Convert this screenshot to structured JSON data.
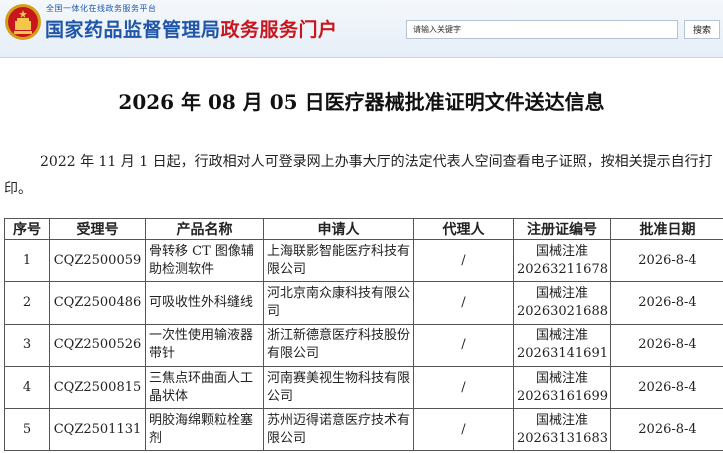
{
  "header": {
    "top_subtitle": "全国一体化在线政务服务平台",
    "site_name_blue": "国家药品监督管理局",
    "site_name_red": "政务服务门户",
    "search_placeholder": "请输入关键字",
    "search_button_label": "搜索"
  },
  "page": {
    "title": "2026 年 08 月 05 日医疗器械批准证明文件送达信息",
    "notice": "2022 年 11 月 1 日起，行政相对人可登录网上办事大厅的法定代表人空间查看电子证照，按相关提示自行打印。"
  },
  "table": {
    "headers": [
      "序号",
      "受理号",
      "产品名称",
      "申请人",
      "代理人",
      "注册证编号",
      "批准日期"
    ],
    "rows": [
      {
        "index": "1",
        "accept_no": "CQZ2500059",
        "product": "骨转移 CT 图像辅助检测软件",
        "applicant": "上海联影智能医疗科技有限公司",
        "agent": "/",
        "cert_no": "国械注准 20263211678",
        "date": "2026-8-4"
      },
      {
        "index": "2",
        "accept_no": "CQZ2500486",
        "product": "可吸收性外科缝线",
        "applicant": "河北京南众康科技有限公司",
        "agent": "/",
        "cert_no": "国械注准 20263021688",
        "date": "2026-8-4"
      },
      {
        "index": "3",
        "accept_no": "CQZ2500526",
        "product": "一次性使用输液器　　带针",
        "applicant": "浙江新德意医疗科技股份有限公司",
        "agent": "/",
        "cert_no": "国械注准 20263141691",
        "date": "2026-8-4"
      },
      {
        "index": "4",
        "accept_no": "CQZ2500815",
        "product": "三焦点环曲面人工晶状体",
        "applicant": "河南赛美视生物科技有限公司",
        "agent": "/",
        "cert_no": "国械注准 20263161699",
        "date": "2026-8-4"
      },
      {
        "index": "5",
        "accept_no": "CQZ2501131",
        "product": "明胶海绵颗粒栓塞剂",
        "applicant": "苏州迈得诺意医疗技术有限公司",
        "agent": "/",
        "cert_no": "国械注准 20263131683",
        "date": "2026-8-4"
      }
    ]
  },
  "colors": {
    "brand_blue": "#1f56a8",
    "brand_red": "#c8161d"
  }
}
